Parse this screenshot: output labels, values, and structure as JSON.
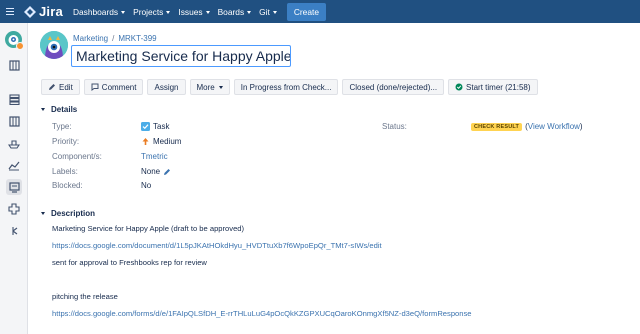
{
  "nav": {
    "logo_text": "Jira",
    "items": [
      {
        "label": "Dashboards"
      },
      {
        "label": "Projects"
      },
      {
        "label": "Issues"
      },
      {
        "label": "Boards"
      },
      {
        "label": "Git"
      }
    ],
    "create_label": "Create"
  },
  "breadcrumb": {
    "project": "Marketing",
    "separator": "/",
    "issue_key": "MRKT-399"
  },
  "summary": "Marketing Service for Happy Apple",
  "toolbar": {
    "edit": "Edit",
    "comment": "Comment",
    "assign": "Assign",
    "more": "More",
    "transition1": "In Progress from Check...",
    "transition2": "Closed (done/rejected)...",
    "timer": "Start timer (21:58)"
  },
  "details": {
    "title": "Details",
    "type_label": "Type:",
    "type_value": "Task",
    "priority_label": "Priority:",
    "priority_value": "Medium",
    "components_label": "Component/s:",
    "components_value": "Tmetric",
    "labels_label": "Labels:",
    "labels_value": "None",
    "blocked_label": "Blocked:",
    "blocked_value": "No",
    "status_label": "Status:",
    "status_value": "CHECK RESULT",
    "workflow_open": "(",
    "workflow_link": "View Workflow",
    "workflow_close": ")"
  },
  "description": {
    "title": "Description",
    "lines": [
      "Marketing Service for Happy Apple (draft to be approved)",
      "https://docs.google.com/document/d/1L5pJKAtHOkdHyu_HVDTtuXb7f6WpoEpQr_TMt7-sIWs/edit",
      "sent for approval to Freshbooks rep for review",
      "pitching the release",
      "https://docs.google.com/forms/d/e/1FAIpQLSfDH_E-rrTHLuLuG4pOcQkKZGPXUCqOaroKOnmgXf5NZ-d3eQ/formResponse"
    ]
  },
  "colors": {
    "nav_bg": "#205081",
    "create_bg": "#3b7fc4",
    "link": "#3b73af",
    "status_lozenge": "#ffd351"
  }
}
